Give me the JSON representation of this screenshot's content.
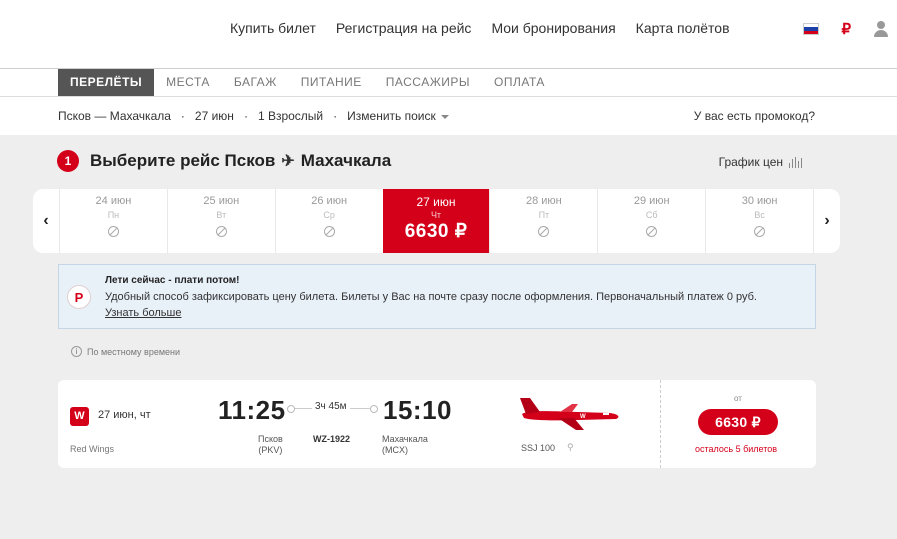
{
  "header": {
    "nav": [
      "Купить билет",
      "Регистрация на рейс",
      "Мои бронирования",
      "Карта полётов"
    ],
    "currency_symbol": "₽"
  },
  "tabs": [
    "ПЕРЕЛЁТЫ",
    "МЕСТА",
    "БАГАЖ",
    "ПИТАНИЕ",
    "ПАССАЖИРЫ",
    "ОПЛАТА"
  ],
  "search": {
    "route": "Псков — Махачкала",
    "date": "27 июн",
    "passengers": "1 Взрослый",
    "change": "Изменить поиск",
    "promo": "У вас есть промокод?"
  },
  "title": {
    "step": "1",
    "text": "Выберите рейс Псков",
    "destination": "Махачкала",
    "price_graph": "График цен"
  },
  "days": [
    {
      "date": "24 июн",
      "weekday": "Пн",
      "price": ""
    },
    {
      "date": "25 июн",
      "weekday": "Вт",
      "price": ""
    },
    {
      "date": "26 июн",
      "weekday": "Ср",
      "price": ""
    },
    {
      "date": "27 июн",
      "weekday": "Чт",
      "price": "6630 ₽"
    },
    {
      "date": "28 июн",
      "weekday": "Пт",
      "price": ""
    },
    {
      "date": "29 июн",
      "weekday": "Сб",
      "price": ""
    },
    {
      "date": "30 июн",
      "weekday": "Вс",
      "price": ""
    }
  ],
  "banner": {
    "title": "Лети сейчас - плати потом!",
    "text": "Удобный способ зафиксировать цену билета. Билеты у Вас на почте сразу после оформления. Первоначальный платеж 0 руб.",
    "link": "Узнать больше"
  },
  "local_time": "По местному времени",
  "flight": {
    "date": "27 июн, чт",
    "airline": "Red Wings",
    "dep_time": "11:25",
    "arr_time": "15:10",
    "duration": "3ч 45м",
    "flight_no": "WZ-1922",
    "dep_city": "Псков",
    "dep_code": "(PKV)",
    "arr_city": "Махачкала",
    "arr_code": "(MCX)",
    "aircraft": "SSJ 100",
    "price_from": "от",
    "price": "6630 ₽",
    "seats_left": "осталось 5 билетов"
  },
  "colors": {
    "brand": "#d4001a",
    "banner_bg": "#e8f0f8"
  }
}
